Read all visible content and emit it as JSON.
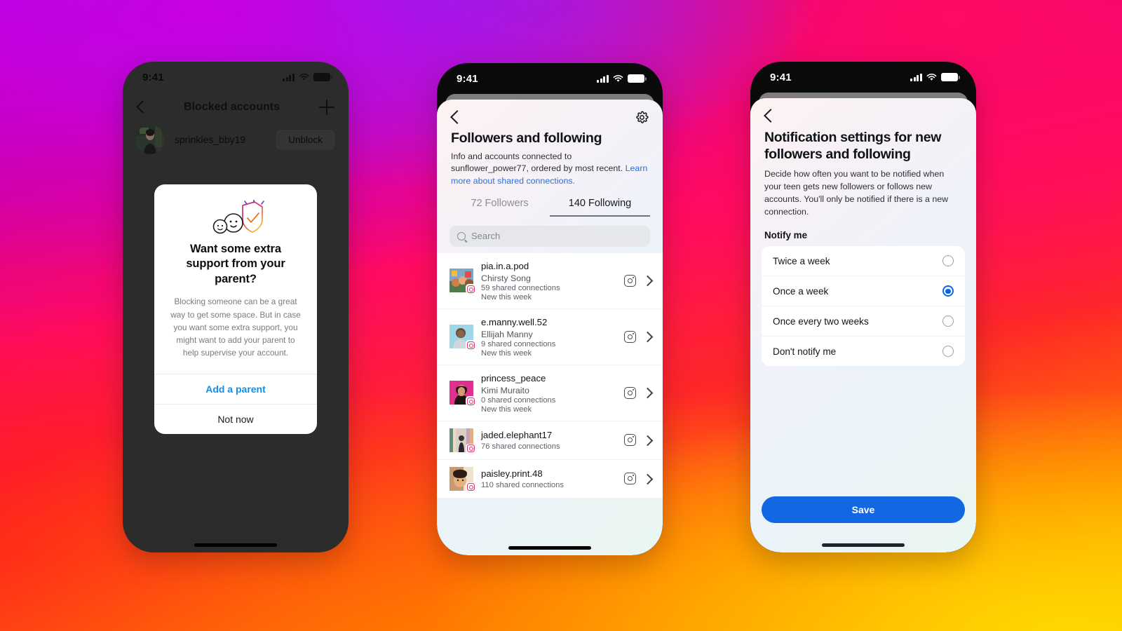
{
  "theme": {
    "accent_blue": "#0a66e0",
    "link_blue": "#2f6fd6",
    "save_button_blue": "#1268e3",
    "instagram_pink": "#e1306c",
    "muted_text": "#7b7b7b"
  },
  "phone1": {
    "status": {
      "time": "9:41",
      "signal_icon": "cellular-bars-icon",
      "wifi_icon": "wifi-icon",
      "battery_icon": "battery-icon"
    },
    "nav": {
      "back_icon": "chevron-left-icon",
      "title": "Blocked accounts",
      "add_icon": "plus-icon"
    },
    "blocked_account": {
      "username": "sprinkles_bby19",
      "action_label": "Unblock",
      "avatar": "avatar"
    },
    "modal": {
      "illustration": "parent-supervision-shield-icon",
      "title": "Want some extra support from your parent?",
      "body": "Blocking someone can be a great way to get some space. But in case you want some extra support, you might want to add your parent to help supervise your account.",
      "primary_action": "Add a parent",
      "secondary_action": "Not now"
    }
  },
  "phone2": {
    "status": {
      "time": "9:41",
      "signal_icon": "cellular-bars-icon",
      "wifi_icon": "wifi-icon",
      "battery_icon": "battery-icon"
    },
    "topbar": {
      "back_icon": "chevron-left-icon",
      "settings_icon": "gear-icon"
    },
    "header": {
      "title": "Followers and following",
      "subtitle": "Info and accounts connected to sunflower_power77, ordered by most recent.",
      "link": "Learn more about shared connections."
    },
    "tabs": [
      {
        "label": "72 Followers",
        "active": false
      },
      {
        "label": "140 Following",
        "active": true
      }
    ],
    "search": {
      "placeholder": "Search",
      "icon": "search-icon"
    },
    "list": [
      {
        "username": "pia.in.a.pod",
        "name": "Chirsty Song",
        "connections": "59 shared connections",
        "status": "New this week",
        "badge_icon": "instagram-icon",
        "action_icon": "instagram-icon",
        "chevron_icon": "chevron-right-icon"
      },
      {
        "username": "e.manny.well.52",
        "name": "Ellijah Manny",
        "connections": "9 shared connections",
        "status": "New this week",
        "badge_icon": "instagram-icon",
        "action_icon": "instagram-icon",
        "chevron_icon": "chevron-right-icon"
      },
      {
        "username": "princess_peace",
        "name": "Kimi Muraito",
        "connections": "0 shared connections",
        "status": "New this week",
        "badge_icon": "instagram-icon",
        "action_icon": "instagram-icon",
        "chevron_icon": "chevron-right-icon"
      },
      {
        "username": "jaded.elephant17",
        "name": "",
        "connections": "76 shared connections",
        "status": "",
        "badge_icon": "instagram-icon",
        "action_icon": "instagram-icon",
        "chevron_icon": "chevron-right-icon"
      },
      {
        "username": "paisley.print.48",
        "name": "",
        "connections": "110 shared connections",
        "status": "",
        "badge_icon": "instagram-icon",
        "action_icon": "instagram-icon",
        "chevron_icon": "chevron-right-icon"
      }
    ]
  },
  "phone3": {
    "status": {
      "time": "9:41",
      "signal_icon": "cellular-bars-icon",
      "wifi_icon": "wifi-icon",
      "battery_icon": "battery-icon"
    },
    "topbar": {
      "back_icon": "chevron-left-icon"
    },
    "header": {
      "title": "Notification settings for new followers and following",
      "subtitle": "Decide how often you want to be notified when your teen gets new followers or follows new accounts. You'll only be notified if there is a new connection."
    },
    "section_label": "Notify me",
    "options": [
      {
        "label": "Twice a week",
        "selected": false
      },
      {
        "label": "Once a week",
        "selected": true
      },
      {
        "label": "Once every two weeks",
        "selected": false
      },
      {
        "label": "Don't notify me",
        "selected": false
      }
    ],
    "save_label": "Save"
  }
}
